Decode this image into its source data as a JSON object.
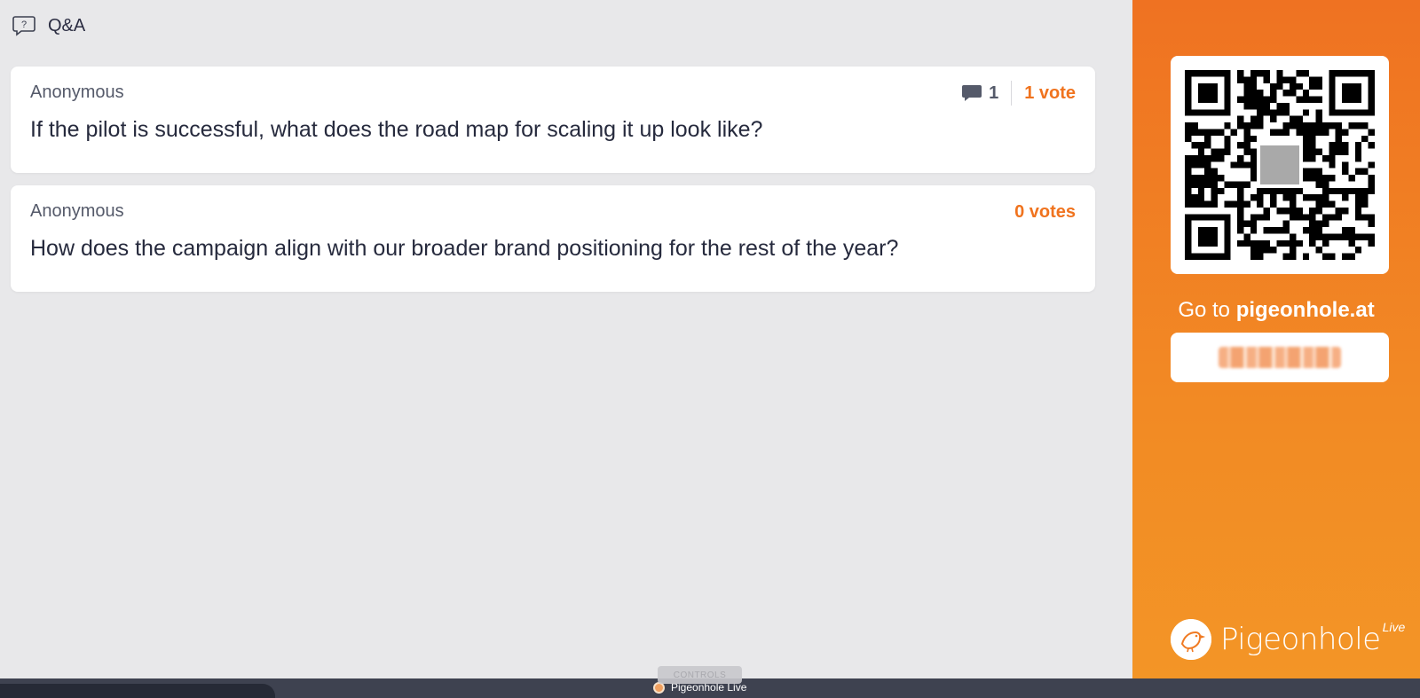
{
  "header": {
    "title": "Q&A",
    "icon": "question-bubble-icon"
  },
  "questions": [
    {
      "author": "Anonymous",
      "text": "If the pilot is successful, what does the road map for scaling it up look like?",
      "comments": "1",
      "votes": "1 vote"
    },
    {
      "author": "Anonymous",
      "text": "How does the campaign align with our broader brand positioning for the rest of the year?",
      "votes": "0 votes"
    }
  ],
  "sidebar": {
    "goto_prefix": "Go to",
    "goto_site": "pigeonhole.at",
    "brand": "Pigeonhole",
    "brand_suffix": "Live",
    "qr_icon": "qr-code-icon"
  },
  "bottom_bar": {
    "controls_label": "CONTROLS",
    "app_name": "Pigeonhole Live"
  },
  "colors": {
    "accent": "#f0731e",
    "sidebar_top": "#ef7222",
    "sidebar_bottom": "#f39526",
    "background": "#e8e8ea"
  }
}
